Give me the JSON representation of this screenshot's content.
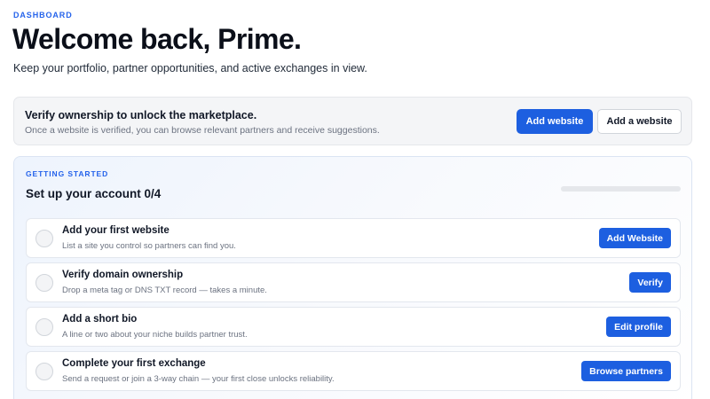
{
  "header": {
    "eyebrow": "DASHBOARD",
    "title": "Welcome back, Prime.",
    "subtitle": "Keep your portfolio, partner opportunities, and active exchanges in view."
  },
  "banner": {
    "title": "Verify ownership to unlock the marketplace.",
    "text": "Once a website is verified, you can browse relevant partners and receive suggestions.",
    "primary_label": "Add website",
    "secondary_label": "Add a website"
  },
  "getting_started": {
    "eyebrow": "GETTING STARTED",
    "title": "Set up your account 0/4",
    "progress_fraction": 0,
    "tasks": [
      {
        "title": "Add your first website",
        "desc": "List a site you control so partners can find you.",
        "button": "Add Website"
      },
      {
        "title": "Verify domain ownership",
        "desc": "Drop a meta tag or DNS TXT record — takes a minute.",
        "button": "Verify"
      },
      {
        "title": "Add a short bio",
        "desc": "A line or two about your niche builds partner trust.",
        "button": "Edit profile"
      },
      {
        "title": "Complete your first exchange",
        "desc": "Send a request or join a 3-way chain — your first close unlocks reliability.",
        "button": "Browse partners"
      }
    ]
  },
  "colors": {
    "accent": "#1d5fe0",
    "eyebrow": "#2563eb"
  },
  "icons": {
    "task_check": "circle-checkbox-icon"
  }
}
